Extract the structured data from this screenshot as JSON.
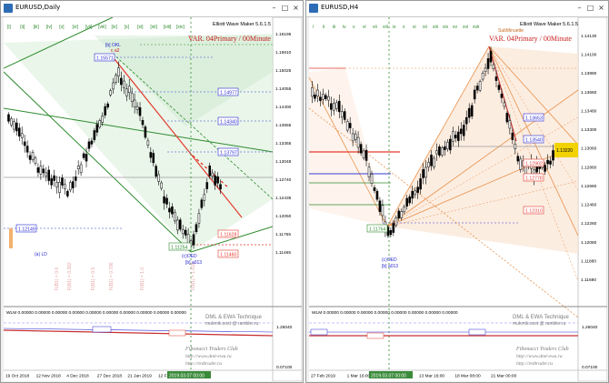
{
  "left_window": {
    "title": "EURUSD,Daily",
    "indicator_name": "Elliott Wave Maker 5.6.1.5",
    "variant_label": "VAR. 04Primary / 00Minute",
    "wave_labels": [
      "[i]",
      "[ii]",
      "[iii]",
      "[iv]",
      "[v]",
      "[vi]",
      "[vii]",
      "[viii]",
      "[ix]",
      "[x]",
      "[xi]",
      "[xii]",
      "[xiii]",
      "[xiv]"
    ],
    "price_axis": [
      "1.16195",
      "1.15610",
      "1.15025",
      "1.14055",
      "1.14400",
      "1.13655",
      "1.13355",
      "1.13048",
      "1.12740",
      "1.12435",
      "1.12050",
      "1.11755",
      "1.11465"
    ],
    "boxes": [
      {
        "text": "1.15571",
        "type": "blue"
      },
      {
        "text": "1.14977",
        "type": "blue"
      },
      {
        "text": "1.14340",
        "type": "blue"
      },
      {
        "text": "1.13797",
        "type": "blue"
      },
      {
        "text": "1.12149",
        "type": "blue"
      },
      {
        "text": "1.11254",
        "type": "green"
      },
      {
        "text": "1.11628",
        "type": "red"
      },
      {
        "text": "1.11460",
        "type": "red"
      }
    ],
    "small_labels": {
      "top_wave": "[b] OKL",
      "top_wave2": "c a2",
      "bottom_wave": "(a) LD",
      "wave_c": "(c)OED",
      "wave_b": "[b] a013"
    },
    "sub_indicator": "WLM 0.00000 0.00000 0.00000 0.00000 0.00000 0.00000 0.00000 0.00000 0.00000 0.00000",
    "sub_axis_top": "1.26040",
    "sub_axis_bottom": "0.07100",
    "credits": [
      "DML & EWA Technique",
      "mukmik.oost @ rambler.ru",
      "Fibonacci   Traders   Club",
      "http://www.dml-ewa.ru",
      "http://redtrader.ru"
    ],
    "dates": [
      "19 Oct 2018",
      "12 Nov 2018",
      "4 Dec 2018",
      "27 Dec 2018",
      "21 Jan 2019",
      "12 Feb 2019"
    ],
    "date_highlight": "2019.03.07 00:00"
  },
  "right_window": {
    "title": "EURUSD,H4",
    "indicator_name": "Elliott Wave Maker 5.6.1.5",
    "variant_label": "VAR. 04Primary / 00Minute",
    "sub_title": "SubMinuette",
    "wave_labels": [
      "i",
      "ii",
      "iii",
      "iv",
      "v",
      "vi",
      "vii",
      "viii",
      "ix",
      "x",
      "xi",
      "xii",
      "xiii",
      "xiv",
      "xv",
      "xvi",
      "xvii"
    ],
    "price_axis": [
      "1.14130",
      "1.14100",
      "1.13880",
      "1.13660",
      "1.13460",
      "1.13300",
      "1.13060",
      "1.12860",
      "1.12660",
      "1.12460",
      "1.12260",
      "1.12080",
      "1.11880",
      "1.11680"
    ],
    "boxes": [
      {
        "text": "1.13653",
        "type": "blue"
      },
      {
        "text": "1.13540",
        "type": "blue"
      },
      {
        "text": "1.12902",
        "type": "red"
      },
      {
        "text": "1.12778",
        "type": "red"
      },
      {
        "text": "1.12310",
        "type": "red"
      },
      {
        "text": "1.11764",
        "type": "green"
      },
      {
        "text": "1.13220",
        "type": "yellow"
      }
    ],
    "small_labels": {
      "wave_c": "(c)OED",
      "wave_b": "[b] a013"
    },
    "sub_indicator": "WLM 0.00000 0.00000 0.00000 0.00000 0.00000 0.00000 0.00000 0.00000",
    "sub_axis_top": "1.26040",
    "sub_axis_bottom": "0.07100",
    "credits": [
      "DML & EWA Technique",
      "mukmik.oost @ rambler.ru",
      "Fibonacci   Traders   Club",
      "http://www.dml-ewa.ru",
      "http://redtrader.ru"
    ],
    "dates": [
      "27 Feb 2019",
      "1 Mar 16:00",
      "5 Mar 08:00",
      "13 Mar 16:00",
      "18 Mar 08:00",
      "21 Mar 00:00"
    ],
    "date_highlight": "2019.03.07 00:00"
  },
  "window_buttons": {
    "minimize": "–",
    "maximize": "□",
    "close": "×"
  },
  "colors": {
    "bull": "#000000",
    "grid": "#b8c4e0",
    "green": "#2e8b2e",
    "red": "#e33a2e",
    "orange": "#e8914a",
    "blue": "#2a2ad4",
    "accent_yellow": "#f2d200"
  }
}
